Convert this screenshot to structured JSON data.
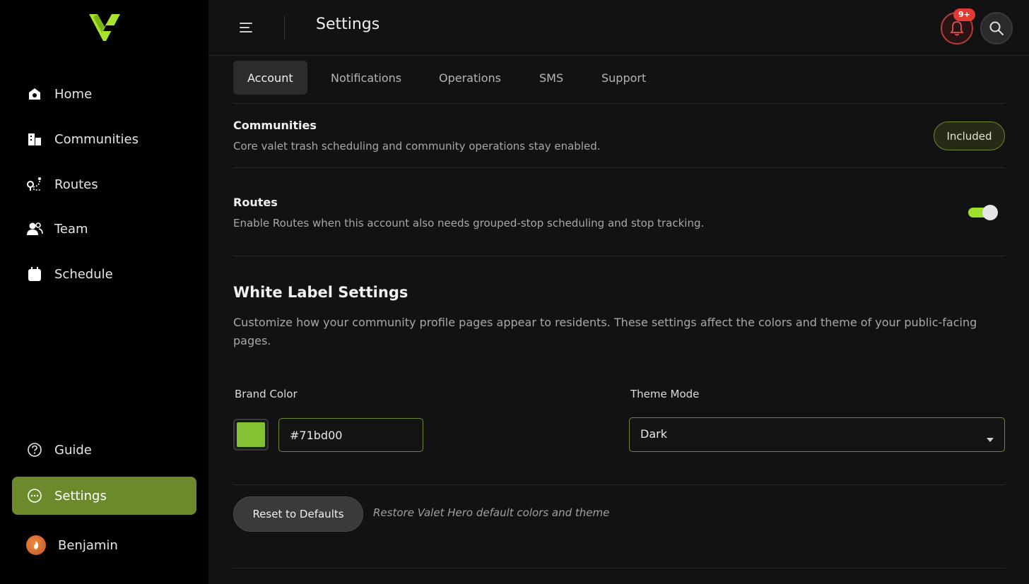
{
  "app": {
    "page_title": "Settings",
    "brand_color": "#71bd00",
    "accent_active": "#6c8a2c"
  },
  "sidebar": {
    "items": [
      {
        "label": "Home",
        "icon": "home-icon"
      },
      {
        "label": "Communities",
        "icon": "buildings-icon"
      },
      {
        "label": "Routes",
        "icon": "route-icon"
      },
      {
        "label": "Team",
        "icon": "team-icon"
      },
      {
        "label": "Schedule",
        "icon": "calendar-icon"
      }
    ],
    "bottom_items": [
      {
        "label": "Guide",
        "icon": "help-icon"
      },
      {
        "label": "Settings",
        "icon": "settings-dots-icon",
        "active": true
      }
    ],
    "user": {
      "name": "Benjamin"
    }
  },
  "header": {
    "notification_badge": "9+"
  },
  "tabs": [
    {
      "label": "Account",
      "active": true
    },
    {
      "label": "Notifications"
    },
    {
      "label": "Operations"
    },
    {
      "label": "SMS"
    },
    {
      "label": "Support"
    }
  ],
  "communities": {
    "title": "Communities",
    "description": "Core valet trash scheduling and community operations stay enabled.",
    "badge": "Included"
  },
  "routes": {
    "title": "Routes",
    "description": "Enable Routes when this account also needs grouped-stop scheduling and stop tracking.",
    "enabled": true
  },
  "white_label": {
    "title": "White Label Settings",
    "description": "Customize how your community profile pages appear to residents. These settings affect the colors and theme of your public-facing pages.",
    "brand_color_label": "Brand Color",
    "brand_color_value": "#71bd00",
    "swatch_color": "#84c234",
    "theme_mode_label": "Theme Mode",
    "theme_mode_value": "Dark",
    "reset_label": "Reset to Defaults",
    "reset_note": "Restore Valet Hero default colors and theme"
  }
}
